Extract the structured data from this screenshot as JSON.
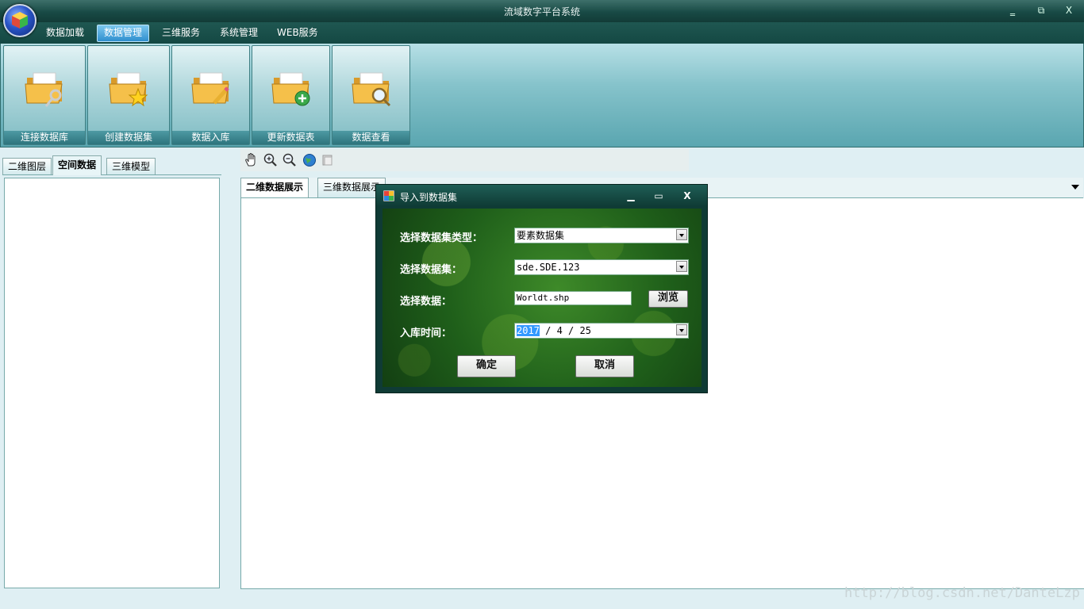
{
  "window": {
    "title": "流域数字平台系统",
    "controls": {
      "minimize": "‗",
      "restore": "⧉",
      "close": "X"
    }
  },
  "menu": [
    {
      "label": "数据加载",
      "active": false
    },
    {
      "label": "数据管理",
      "active": true
    },
    {
      "label": "三维服务",
      "active": false
    },
    {
      "label": "系统管理",
      "active": false
    },
    {
      "label": "WEB服务",
      "active": false
    }
  ],
  "ribbon": [
    {
      "label": "连接数据库",
      "icon": "folder-key-icon"
    },
    {
      "label": "创建数据集",
      "icon": "folder-star-icon"
    },
    {
      "label": "数据入库",
      "icon": "folder-pencil-icon"
    },
    {
      "label": "更新数据表",
      "icon": "folder-add-icon"
    },
    {
      "label": "数据查看",
      "icon": "folder-search-icon"
    }
  ],
  "left_tabs": [
    {
      "label": "二维图层",
      "active": false
    },
    {
      "label": "空间数据",
      "active": true
    },
    {
      "label": "三维模型",
      "active": false
    }
  ],
  "map_tools": [
    "pan-hand-icon",
    "zoom-in-icon",
    "zoom-out-icon",
    "globe-icon",
    "layers-icon"
  ],
  "right_tabs": [
    {
      "label": "二维数据展示",
      "active": true
    },
    {
      "label": "三维数据展示",
      "active": false
    }
  ],
  "dialog": {
    "title": "导入到数据集",
    "fields": {
      "dataset_type_label": "选择数据集类型：",
      "dataset_type_value": "要素数据集",
      "dataset_label": "选择数据集：",
      "dataset_value": "sde.SDE.123",
      "data_label": "选择数据：",
      "data_value": "Worldt.shp",
      "browse_label": "浏览",
      "time_label": "入库时间：",
      "time_year": "2017",
      "time_rest": "/ 4 / 25"
    },
    "ok_label": "确定",
    "cancel_label": "取消"
  },
  "watermark": "http://blog.csdn.net/DanteLzp",
  "colors": {
    "titlebar": "#184a45",
    "ribbon": "#86c3cb",
    "menu_active": "#2f8fcf",
    "dialog_bg": "#1f5f1a"
  }
}
